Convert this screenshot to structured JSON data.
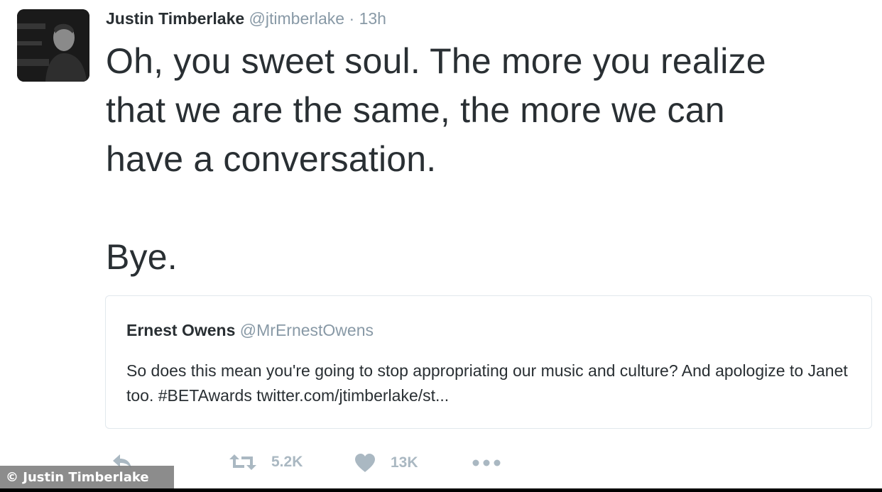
{
  "tweet": {
    "author_name": "Justin Timberlake",
    "author_handle": "@jtimberlake",
    "separator": "·",
    "time": "13h",
    "text": "Oh, you sweet soul. The more you realize\nthat we are the same, the more we can\nhave a conversation.\n\nBye."
  },
  "quoted_tweet": {
    "author_name": "Ernest Owens",
    "author_handle": "@MrErnestOwens",
    "text": "So does this mean you're going to stop appropriating our music and culture? And apologize to Janet too. #BETAwards twitter.com/jtimberlake/st..."
  },
  "actions": {
    "reply_icon": "reply-icon",
    "retweet_icon": "retweet-icon",
    "retweet_count": "5.2K",
    "like_icon": "heart-icon",
    "like_count": "13K",
    "more_icon": "more-dots-icon"
  },
  "watermark": "© Justin Timberlake",
  "colors": {
    "text": "#292f33",
    "muted": "#8899a6",
    "action_gray": "#aab8c2",
    "border": "#e1e8ed"
  }
}
